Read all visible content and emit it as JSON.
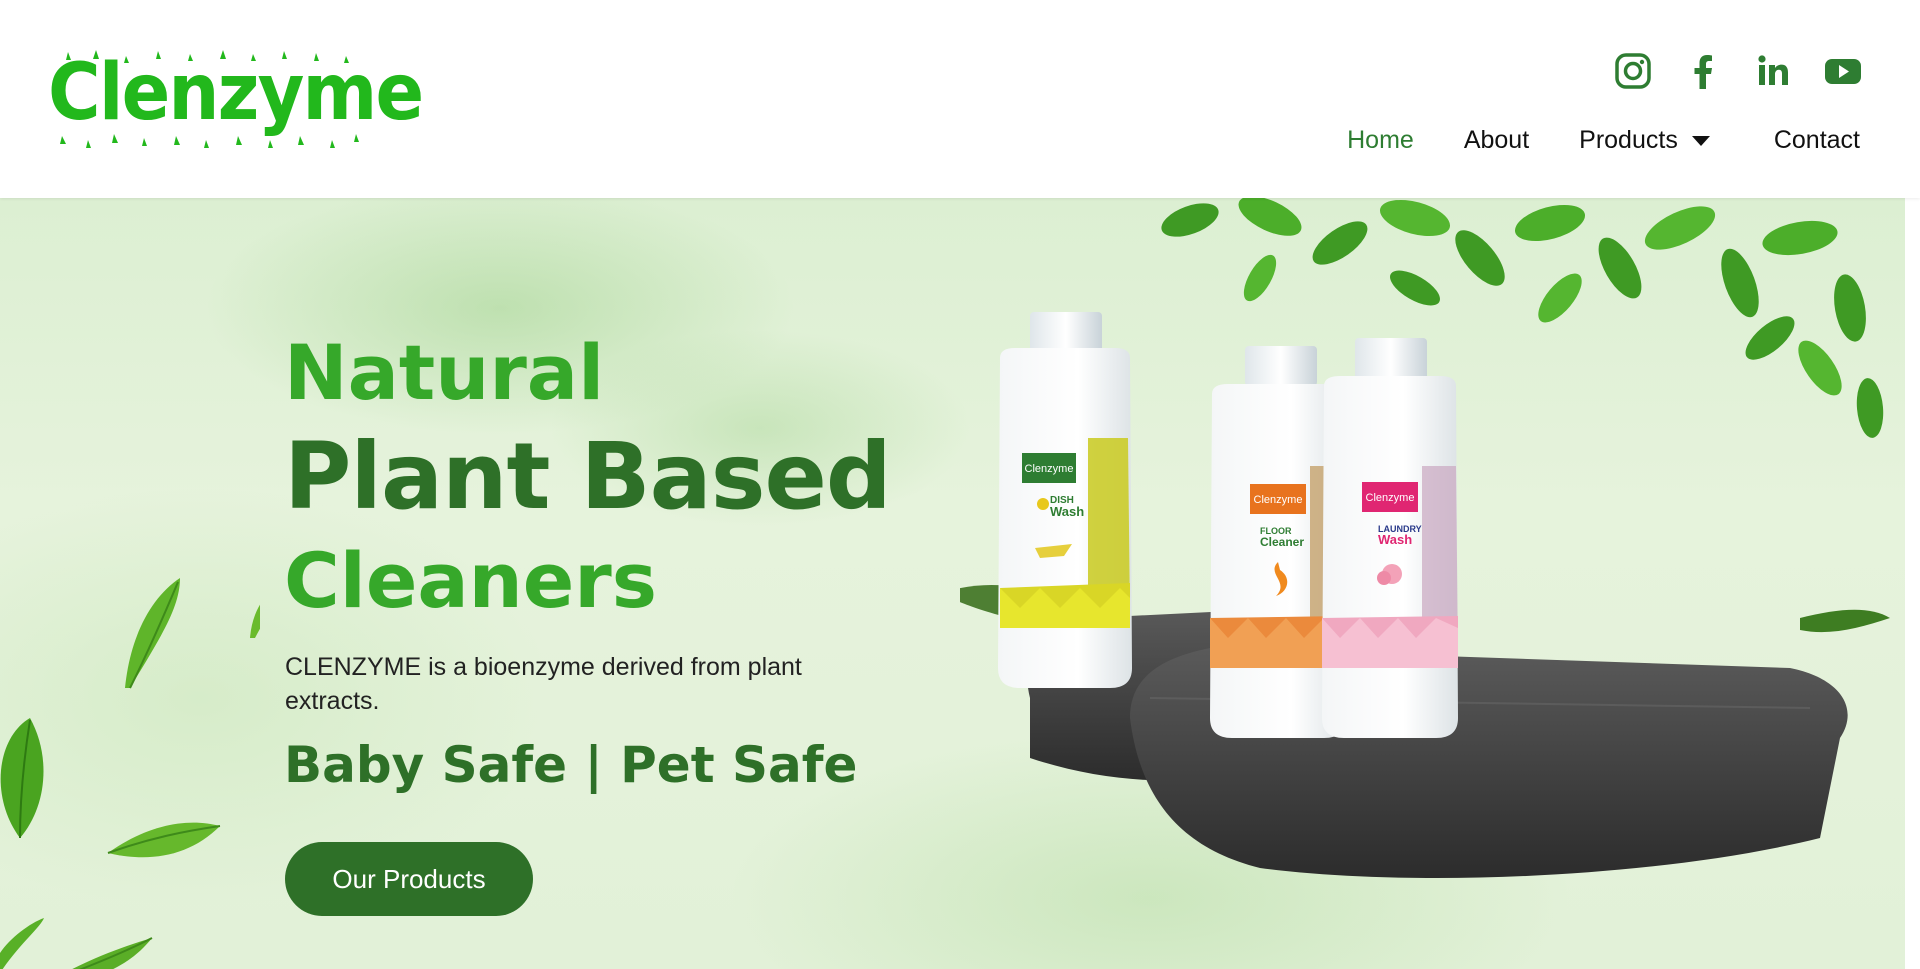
{
  "brand": {
    "name": "Clenzyme",
    "color": "#22b81c"
  },
  "header": {
    "socials": [
      {
        "icon": "instagram-icon",
        "label": "Instagram"
      },
      {
        "icon": "facebook-icon",
        "label": "Facebook"
      },
      {
        "icon": "linkedin-icon",
        "label": "LinkedIn"
      },
      {
        "icon": "youtube-icon",
        "label": "YouTube"
      }
    ],
    "nav": [
      {
        "label": "Home",
        "active": true
      },
      {
        "label": "About",
        "active": false
      },
      {
        "label": "Products",
        "active": false,
        "has_dropdown": true
      },
      {
        "label": "Contact",
        "active": false
      }
    ]
  },
  "hero": {
    "headline_line1": "Natural",
    "headline_line2": "Plant Based",
    "headline_line3": "Cleaners",
    "description": "CLENZYME is a bioenzyme derived from plant extracts.",
    "tagline": "Baby Safe | Pet Safe",
    "cta_label": "Our Products"
  },
  "products": [
    {
      "brand": "Clenzyme",
      "name_top": "DISH",
      "name_bottom": "Wash",
      "label_color": "#2e7d32",
      "band_color": "#d4d222"
    },
    {
      "brand": "Clenzyme",
      "name_top": "FLOOR",
      "name_bottom": "Cleaner",
      "label_color": "#e8731e",
      "band_color": "#eb8a3c"
    },
    {
      "brand": "Clenzyme",
      "name_top": "LAUNDRY",
      "name_bottom": "Wash",
      "label_color": "#e02672",
      "band_color": "#f0a8c0"
    }
  ],
  "colors": {
    "primary_dark": "#2e7028",
    "primary_light": "#36a82a",
    "nav_active": "#2e7d32"
  }
}
